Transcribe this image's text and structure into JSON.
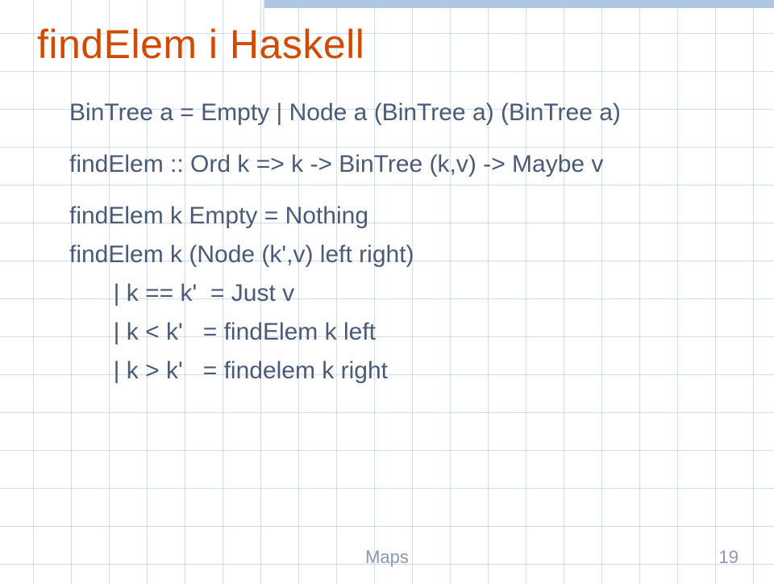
{
  "title": "findElem i Haskell",
  "code": {
    "typedef": "BinTree a = Empty | Node a (BinTree a) (BinTree a)",
    "sig": "findElem :: Ord k => k -> BinTree (k,v) -> Maybe v",
    "def1": "findElem k Empty = Nothing",
    "def2": "findElem k (Node (k',v) left right)",
    "g1": "  | k == k'  = Just v",
    "g2": "  | k < k'   = findElem k left",
    "g3": "  | k > k'   = findelem k right"
  },
  "footer": {
    "topic": "Maps",
    "page": "19"
  }
}
